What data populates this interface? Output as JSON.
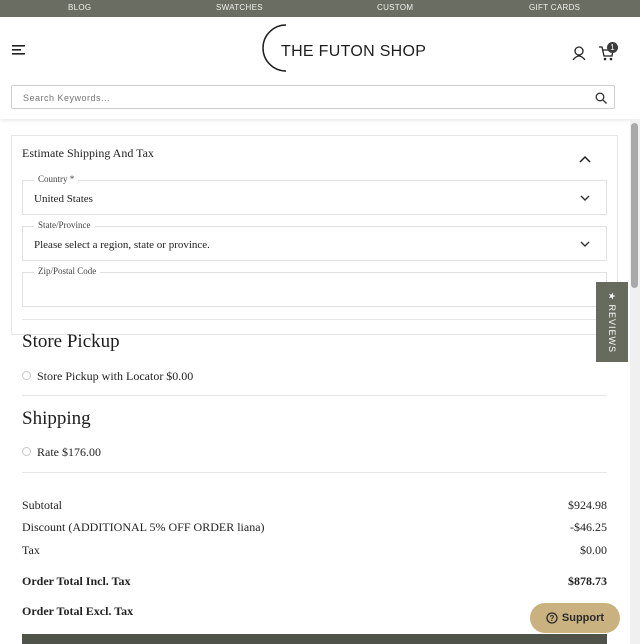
{
  "topbar": {
    "items": [
      "BLOG",
      "SWATCHES",
      "CUSTOM",
      "GIFT CARDS"
    ]
  },
  "header": {
    "logo_text": "THE FUTON SHOP",
    "cart_count": "1"
  },
  "search": {
    "placeholder": "Search Keywords..."
  },
  "estimate": {
    "title": "Estimate Shipping And Tax",
    "country_label": "Country *",
    "country_value": "United States",
    "state_label": "State/Province",
    "state_value": "Please select a region, state or province.",
    "zip_label": "Zip/Postal Code",
    "zip_value": ""
  },
  "store_pickup": {
    "title": "Store Pickup",
    "option": "Store Pickup with Locator $0.00"
  },
  "shipping": {
    "title": "Shipping",
    "option": "Rate $176.00"
  },
  "totals": {
    "subtotal_label": "Subtotal",
    "subtotal_value": "$924.98",
    "discount_label": "Discount (ADDITIONAL 5% OFF ORDER liana)",
    "discount_value": "-$46.25",
    "tax_label": "Tax",
    "tax_value": "$0.00",
    "incl_label": "Order Total Incl. Tax",
    "incl_value": "$878.73",
    "excl_label": "Order Total Excl. Tax"
  },
  "reviews_tab": "★ REVIEWS",
  "support_button": "Support",
  "colors": {
    "topbar": "#6a6d62",
    "reviews": "#676b5e",
    "support": "#c9b27f"
  }
}
